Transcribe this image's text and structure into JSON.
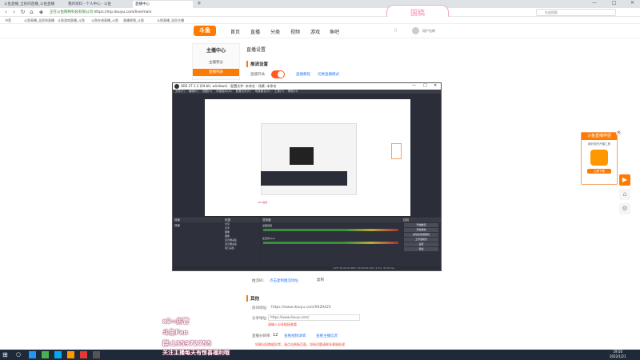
{
  "tabs": [
    "斗鱼直播_全民的直播_斗鱼直播",
    "我的资料 - 个人中心 - 斗鱼",
    "直播中心"
  ],
  "url": "https://mp.douyu.com/live/main",
  "url_prefix": "正在斗鱼网络科技有限公司",
  "bookmarks": [
    "书签",
    "斗鱼直播_全民的直播",
    "斗鱼游戏直播_斗鱼",
    "斗鱼在线直播_斗鱼",
    "直播视频_斗鱼",
    "斗鱼直播_全民主播"
  ],
  "top_right_search": "在此搜索",
  "watermark_top": "国稿",
  "site": {
    "logo": "斗鱼",
    "nav": [
      "首页",
      "直播",
      "分类",
      "视频",
      "游戏",
      "鱼吧"
    ],
    "user": "用户名称"
  },
  "left_panel": {
    "title": "主播中心",
    "items": [
      "主播积分",
      "直播列表"
    ]
  },
  "main": {
    "section_title": "直播设置",
    "sub_title": "推流设置",
    "live_label": "直播开关:",
    "link1": "直播教程",
    "link2": "切换直播模式",
    "label_a": "推流码:",
    "link3": "点击复制推流地址",
    "btn": "复制",
    "other_title": "其他",
    "room_label": "房间地址:",
    "room_url": "https://www.douyu.com/9429425",
    "share_label": "分享地址:",
    "share_url": "https://www.douyu.com/",
    "hint": "请输入分享链接查看",
    "fee_label": "直播分辨率:",
    "fee_value": "12",
    "link4": "查看视频详情",
    "link5": "查看主播信息",
    "warning": "如果出现数据异常，请点击刷新页面，如有问题请联系客服处理"
  },
  "obs": {
    "title": "OBS 27.1.3 (64-bit, windows) - 配置文件: 未命名 - 场景: 未命名",
    "menu": [
      "文件(F)",
      "编辑(E)",
      "视图(V)",
      "停靠窗口(D)",
      "配置文件(P)",
      "场景集合(S)",
      "工具(T)",
      "帮助(H)"
    ],
    "docks": [
      "场景",
      "来源",
      "混音器",
      "场景转换",
      "控制"
    ],
    "scene": "场景",
    "sources": [
      "文字",
      "文字",
      "图像",
      "图像",
      "显示器采集",
      "显示器采集",
      "窗口采集"
    ],
    "mixer": [
      "桌面音频",
      "麦克风/Aux"
    ],
    "controls": [
      "开始推流",
      "开始录制",
      "启动虚拟摄像机",
      "工作室模式",
      "设置",
      "退出"
    ],
    "status": [
      "LIVE: 00:00:00",
      "REC: 00:00:00",
      "CPU: 2.3%, 30.00 fps"
    ]
  },
  "promo": {
    "title": "斗鱼直播伴侣",
    "sub": "超好用的开播工具",
    "btn": "立即下载"
  },
  "overlays": [
    "x2=房管",
    "斗鱼Fan",
    "群:135972755",
    "关注主播每天有惊喜福利哦"
  ],
  "time": "19:50",
  "date": "2022/1/21"
}
